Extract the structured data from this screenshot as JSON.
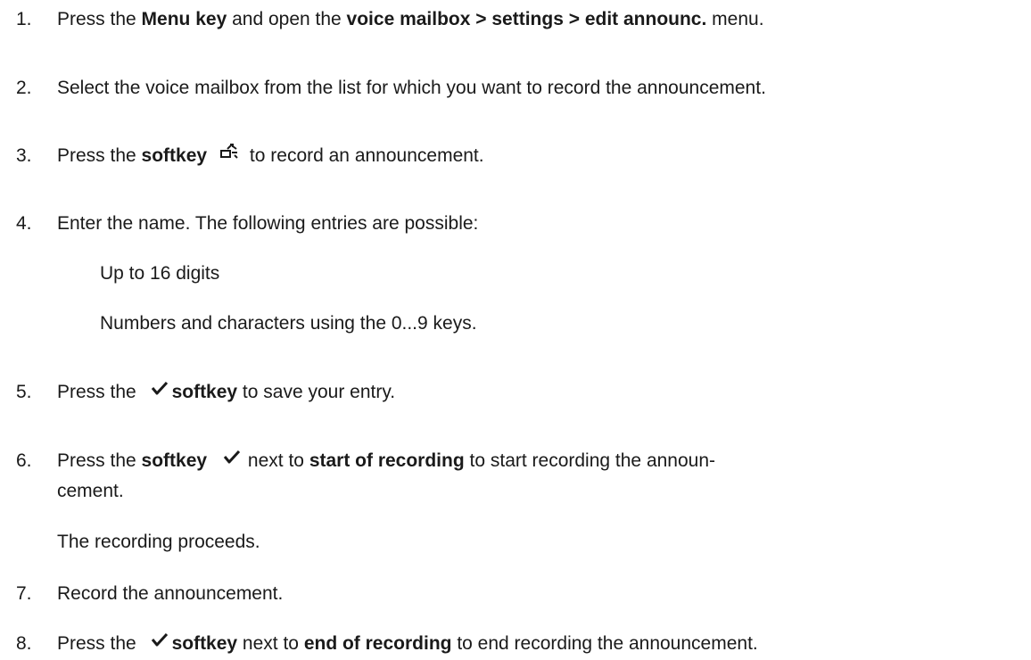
{
  "steps": [
    {
      "num": "1.",
      "parts": [
        "Press the ",
        "Menu key",
        " and open the ",
        "voice mailbox > settings > edit announc.",
        " menu."
      ]
    },
    {
      "num": "2.",
      "text": "Select the voice mailbox from the list for which you want to record the announcement."
    },
    {
      "num": "3.",
      "parts": [
        "Press the ",
        "softkey",
        "to record an announcement."
      ],
      "icon": "record-softkey-icon"
    },
    {
      "num": "4.",
      "text": "Enter the name. The following entries are possible:",
      "sub": [
        "Up to 16 digits",
        "Numbers and characters using the 0...9 keys."
      ]
    },
    {
      "num": "5.",
      "parts": [
        "Press the",
        "softkey",
        " to save your entry."
      ],
      "icon": "checkmark-icon"
    },
    {
      "num": "6.",
      "parts": [
        "Press the ",
        "softkey",
        "next to ",
        "start of recording",
        " to start recording the announ-"
      ],
      "cont": "cement.",
      "note": "The recording proceeds.",
      "icon": "checkmark-icon"
    },
    {
      "num": "7.",
      "text": "Record the announcement."
    },
    {
      "num": "8.",
      "parts": [
        "Press the",
        "softkey",
        " next to ",
        "end of recording",
        " to end recording the announcement."
      ],
      "icon": "checkmark-icon"
    }
  ]
}
